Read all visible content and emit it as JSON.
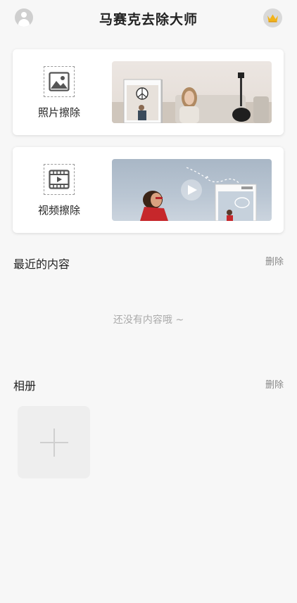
{
  "app": {
    "title": "马赛克去除大师"
  },
  "header": {
    "avatar_icon": "user-avatar-icon",
    "vip_icon": "crown-icon",
    "vip_color": "#f2b31a"
  },
  "cards": [
    {
      "label": "照片擦除",
      "icon": "image-icon"
    },
    {
      "label": "视频擦除",
      "icon": "video-icon"
    }
  ],
  "recent": {
    "title": "最近的内容",
    "action": "删除",
    "empty_text": "还没有内容哦 ~"
  },
  "album": {
    "title": "相册",
    "action": "删除",
    "add_icon": "plus-icon"
  }
}
